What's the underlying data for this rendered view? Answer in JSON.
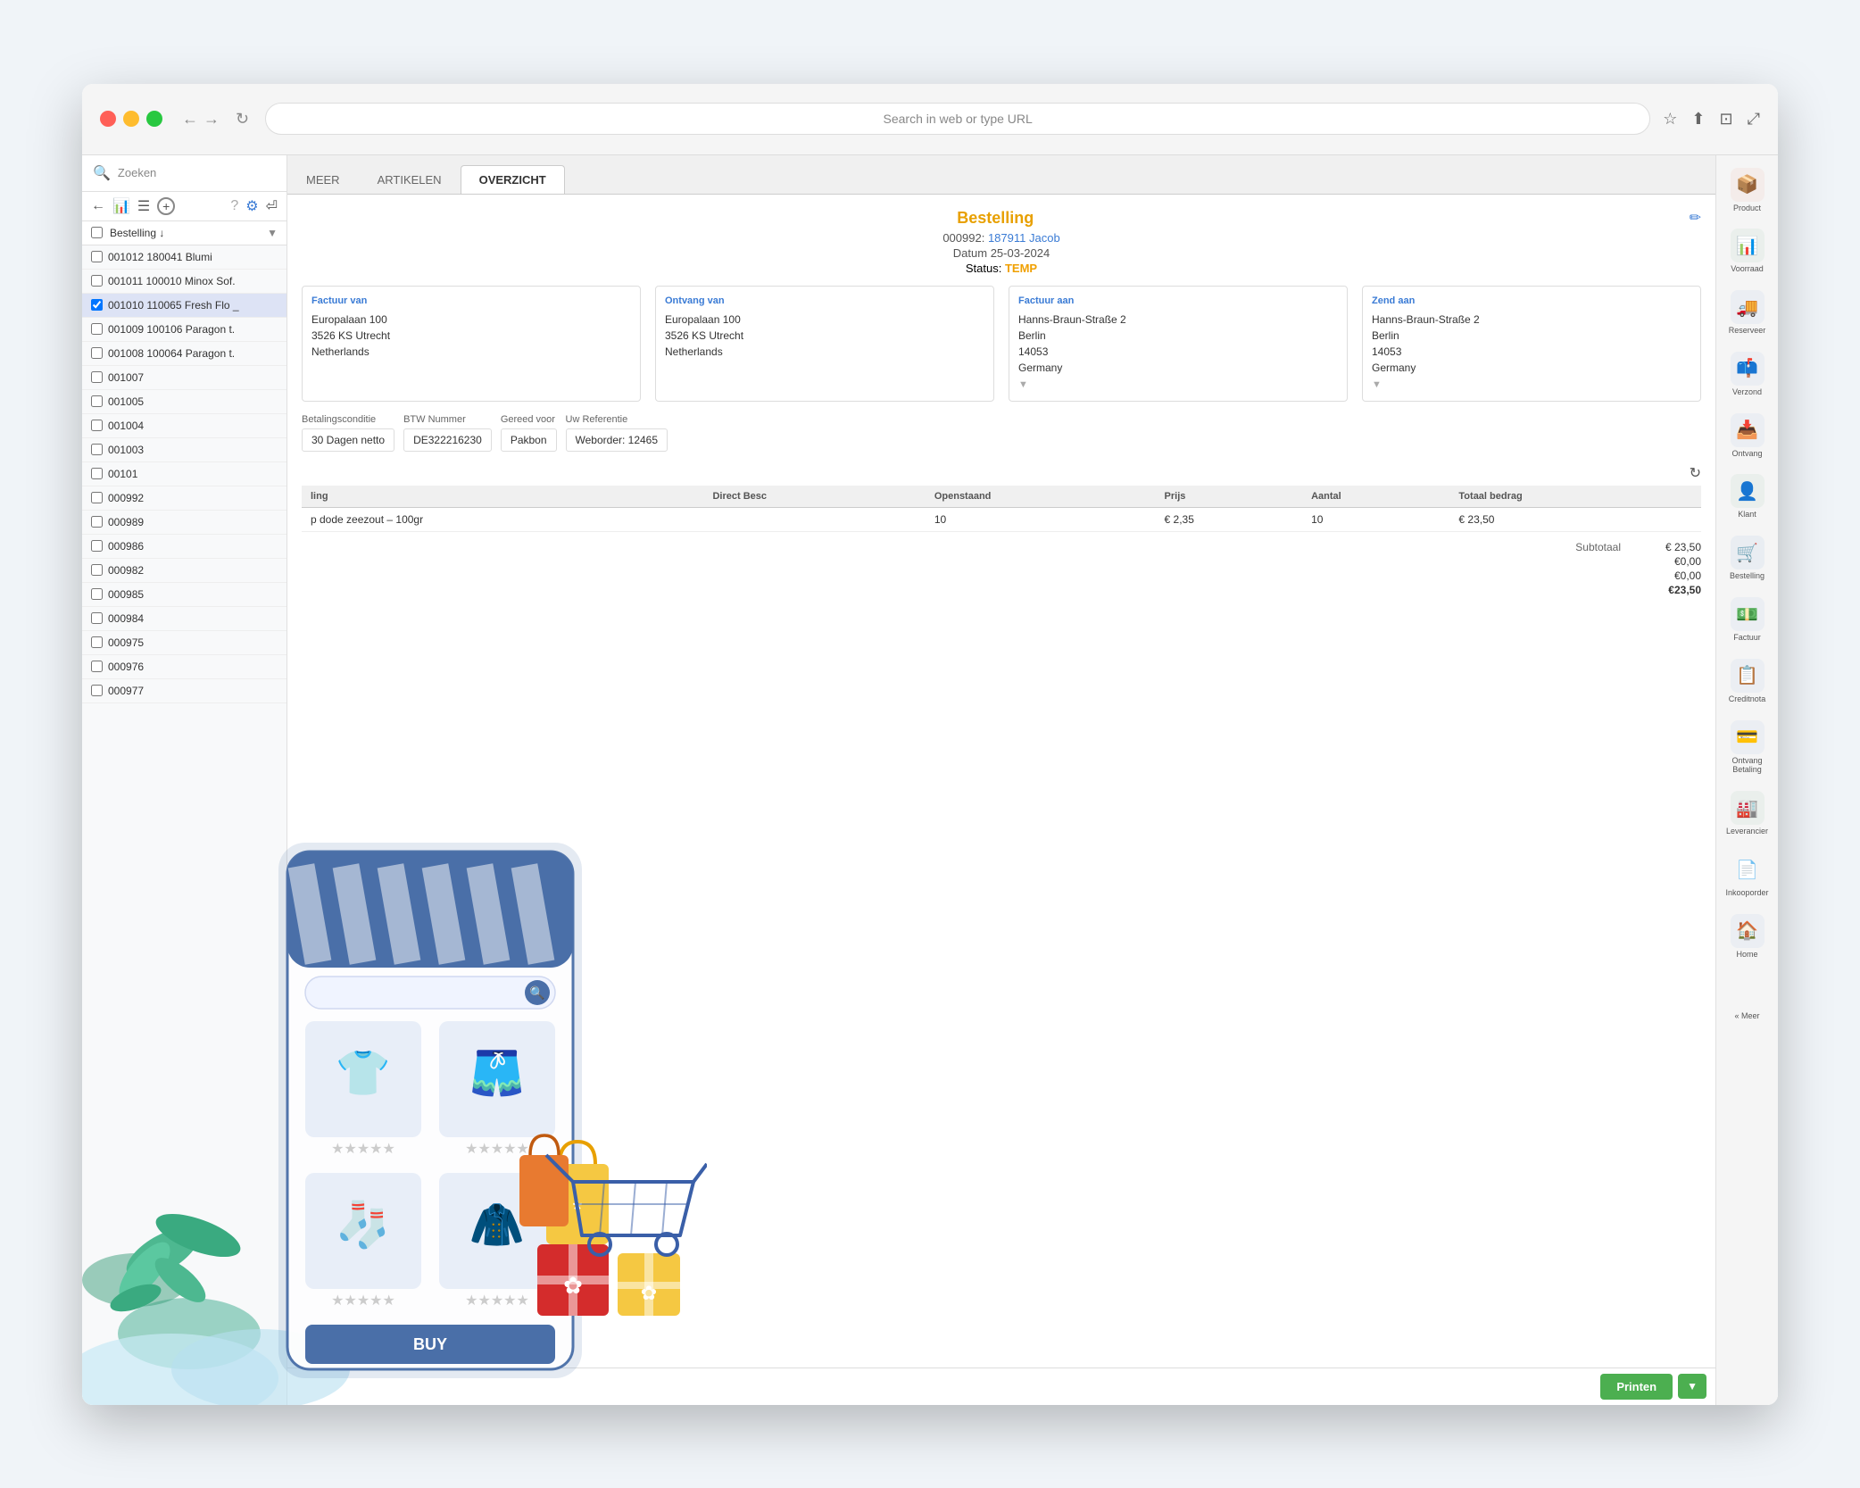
{
  "browser": {
    "address_bar_placeholder": "Search in web or type URL"
  },
  "sidebar": {
    "search_placeholder": "Zoeken",
    "filter_label": "Bestelling ↓",
    "items": [
      {
        "id": "001012",
        "text": "001012 180041 Blumi",
        "active": false
      },
      {
        "id": "001011",
        "text": "001011 100010 Minox Sof.",
        "active": false
      },
      {
        "id": "001010",
        "text": "001010 110065 Fresh Flo _",
        "active": true
      },
      {
        "id": "001009",
        "text": "001009 100106 Paragon t.",
        "active": false
      },
      {
        "id": "001008",
        "text": "001008 100064 Paragon t.",
        "active": false
      },
      {
        "id": "001007",
        "text": "001007",
        "active": false
      },
      {
        "id": "001005",
        "text": "001005",
        "active": false
      },
      {
        "id": "001004",
        "text": "001004",
        "active": false
      },
      {
        "id": "001003",
        "text": "001003",
        "active": false
      },
      {
        "id": "00101",
        "text": "00101",
        "active": false
      },
      {
        "id": "000992",
        "text": "000992",
        "active": false
      },
      {
        "id": "000989",
        "text": "000989",
        "active": false
      },
      {
        "id": "000986",
        "text": "000986",
        "active": false
      },
      {
        "id": "000982",
        "text": "000982",
        "active": false
      },
      {
        "id": "000985",
        "text": "000985",
        "active": false
      },
      {
        "id": "000984",
        "text": "000984",
        "active": false
      },
      {
        "id": "000975",
        "text": "000975",
        "active": false
      },
      {
        "id": "000976",
        "text": "000976",
        "active": false
      },
      {
        "id": "000977",
        "text": "000977",
        "active": false
      }
    ]
  },
  "tabs": {
    "items": [
      {
        "id": "meer",
        "label": "MEER"
      },
      {
        "id": "artikelen",
        "label": "ARTIKELEN"
      },
      {
        "id": "overzicht",
        "label": "OVERZICHT",
        "active": true
      }
    ]
  },
  "order": {
    "title": "Bestelling",
    "number": "000992:",
    "customer": "187911 Jacob",
    "date_label": "Datum",
    "date_value": "25-03-2024",
    "status_label": "Status:",
    "status_value": "TEMP",
    "factuur_van_label": "Factuur van",
    "ontvang_van_label": "Ontvang van",
    "factuur_aan_label": "Factuur aan",
    "zend_aan_label": "Zend aan",
    "factuur_van_address": "Europalaan 100\n3526 KS Utrecht\nNetherlands",
    "ontvang_van_address": "Europalaan 100\n3526 KS Utrecht\nNetherlands",
    "factuur_aan_address": "Hanns-Braun-Straße 2\nBerlin\n14053\nGermany",
    "zend_aan_address": "Hanns-Braun-Straße 2\nBerlin\n14053\nGermany",
    "betalingsconditie_label": "Betalingsconditie",
    "betalingsconditie_value": "30 Dagen netto",
    "btw_nummer_label": "BTW Nummer",
    "btw_nummer_value": "DE322216230",
    "gereed_voor_label": "Gereed voor",
    "gereed_voor_value": "Pakbon",
    "uw_referentie_label": "Uw Referentie",
    "uw_referentie_value": "Weborder: 12465",
    "table": {
      "columns": [
        "ling",
        "Direct Besc",
        "Openstaand",
        "Prijs",
        "Aantal",
        "Totaal bedrag"
      ],
      "rows": [
        {
          "description": "p dode zeezout – 100gr",
          "direct": "",
          "openstaand": "10",
          "prijs": "€ 2,35",
          "aantal": "10",
          "totaal": "€ 23,50"
        }
      ]
    },
    "subtotaal_label": "Subtotaal",
    "subtotaal_value": "€ 23,50",
    "btw_row1": "€0,00",
    "btw_row2": "€0,00",
    "totaal_value": "€23,50",
    "print_button": "Printen"
  },
  "right_sidebar": {
    "items": [
      {
        "id": "product",
        "label": "Product",
        "color": "#e8734a",
        "icon": "📦"
      },
      {
        "id": "voorraad",
        "label": "Voorraad",
        "color": "#4a9e6e",
        "icon": "📊"
      },
      {
        "id": "reserveer",
        "label": "Reserveer",
        "color": "#5b8dd9",
        "icon": "🚚"
      },
      {
        "id": "verzond",
        "label": "Verzond",
        "color": "#5b8dd9",
        "icon": "📫"
      },
      {
        "id": "ontvang",
        "label": "Ontvang",
        "color": "#5b8dd9",
        "icon": "📥"
      },
      {
        "id": "klant",
        "label": "Klant",
        "color": "#4a9e6e",
        "icon": "👤"
      },
      {
        "id": "bestelling",
        "label": "Bestelling",
        "color": "#3a7bd5",
        "icon": "🛒"
      },
      {
        "id": "factuur",
        "label": "Factuur",
        "color": "#5b8dd9",
        "icon": "💵"
      },
      {
        "id": "creditnota",
        "label": "Creditnota",
        "color": "#5b8dd9",
        "icon": "📋"
      },
      {
        "id": "ontvang_betaling",
        "label": "Ontvang Betaling",
        "color": "#5b8dd9",
        "icon": "💳"
      },
      {
        "id": "leverancier",
        "label": "Leverancier",
        "color": "#4a9e6e",
        "icon": "🏭"
      },
      {
        "id": "inkooporder",
        "label": "Inkooporder",
        "color": "#888",
        "icon": "📄"
      },
      {
        "id": "home",
        "label": "Home",
        "color": "#5b8dd9",
        "icon": "🏠"
      },
      {
        "id": "meer",
        "label": "« Meer",
        "color": "#888",
        "icon": ""
      }
    ]
  },
  "illustration": {
    "buy_button": "BUY"
  }
}
